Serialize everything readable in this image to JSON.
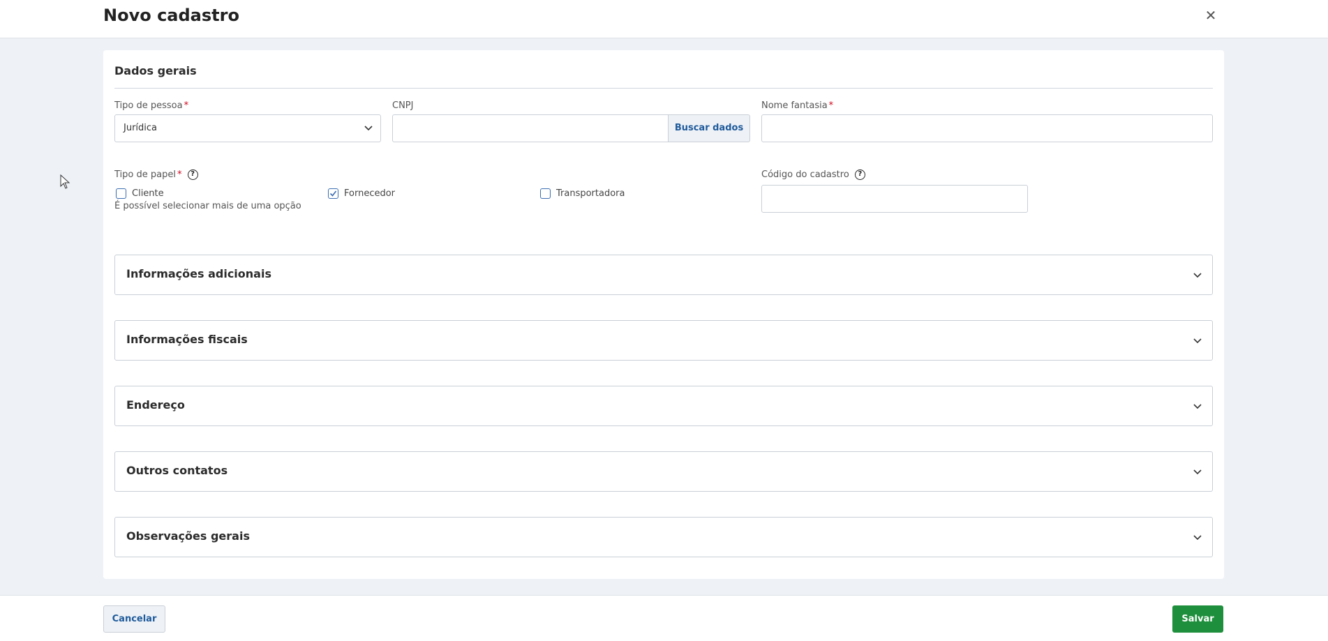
{
  "header": {
    "title": "Novo cadastro",
    "close_icon": "close-icon"
  },
  "dados_gerais": {
    "title": "Dados gerais",
    "tipo_pessoa": {
      "label": "Tipo de pessoa",
      "required_mark": "*",
      "value": "Jurídica"
    },
    "cnpj": {
      "label": "CNPJ",
      "value": "",
      "button_label": "Buscar dados"
    },
    "nome_fantasia": {
      "label": "Nome fantasia",
      "required_mark": "*",
      "value": ""
    },
    "tipo_papel": {
      "label": "Tipo de papel",
      "required_mark": "*",
      "help_icon": "help-icon",
      "options": [
        {
          "label": "Cliente",
          "checked": false
        },
        {
          "label": "Fornecedor",
          "checked": true
        },
        {
          "label": "Transportadora",
          "checked": false
        }
      ],
      "hint": "É possível selecionar mais de uma opção"
    },
    "codigo_cadastro": {
      "label": "Código do cadastro",
      "help_icon": "help-icon",
      "value": ""
    }
  },
  "sections": [
    {
      "title": "Informações adicionais"
    },
    {
      "title": "Informações fiscais"
    },
    {
      "title": "Endereço"
    },
    {
      "title": "Outros contatos"
    },
    {
      "title": "Observações gerais"
    }
  ],
  "footer": {
    "cancel_label": "Cancelar",
    "save_label": "Salvar"
  },
  "colors": {
    "accent": "#1f5a9a",
    "save": "#1e8f3c",
    "required": "#d0021b",
    "background": "#eef2f7"
  }
}
